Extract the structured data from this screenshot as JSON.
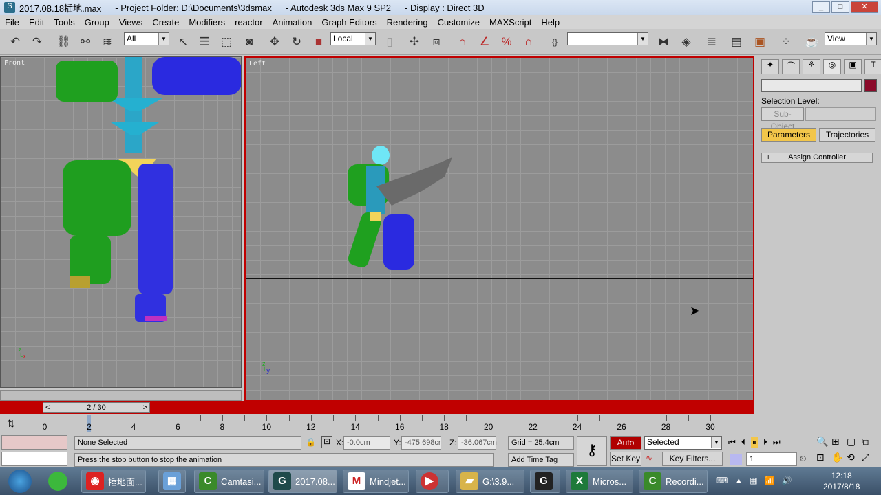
{
  "title": {
    "file": "2017.08.18插地.max",
    "project": "- Project Folder: D:\\Documents\\3dsmax",
    "app": "- Autodesk 3ds Max 9 SP2",
    "display": "- Display : Direct 3D"
  },
  "menu": [
    "File",
    "Edit",
    "Tools",
    "Group",
    "Views",
    "Create",
    "Modifiers",
    "reactor",
    "Animation",
    "Graph Editors",
    "Rendering",
    "Customize",
    "MAXScript",
    "Help"
  ],
  "toolbar": {
    "selection_filter": "All",
    "reference_coord": "Local",
    "named_selection": "",
    "render_type": "View"
  },
  "viewports": {
    "front": "Front",
    "left": "Left"
  },
  "command_panel": {
    "name_field": "",
    "color": "#8b0a2a",
    "selection_level": "Selection Level:",
    "sub_object": "Sub-Object",
    "parameters": "Parameters",
    "trajectories": "Trajectories",
    "assign_controller": "Assign Controller",
    "rollout_toggle": "+"
  },
  "timeline": {
    "current": "2 / 30",
    "current_frame": 2,
    "total_frames": 30,
    "ticks": [
      "0",
      "2",
      "4",
      "6",
      "8",
      "10",
      "12",
      "14",
      "16",
      "18",
      "20",
      "22",
      "24",
      "26",
      "28",
      "30"
    ]
  },
  "status": {
    "selection": "None Selected",
    "prompt": "Press the stop button to stop the animation",
    "x": "-0.0cm",
    "y": "-475.698cr",
    "z": "-36.067cm",
    "x_label": "X:",
    "y_label": "Y:",
    "z_label": "Z:",
    "grid": "Grid = 25.4cm",
    "add_time_tag": "Add Time Tag",
    "auto_key": "Auto Key",
    "set_key": "Set Key",
    "key_mode": "Selected",
    "key_filters": "Key Filters...",
    "frame": "1"
  },
  "taskbar": {
    "items": [
      "插地面...",
      "Camtasi...",
      "2017.08...",
      "Mindjet...",
      "G:\\3.9...",
      "Micros...",
      "Recordi..."
    ],
    "time": "12:18",
    "date": "2017/8/18"
  }
}
